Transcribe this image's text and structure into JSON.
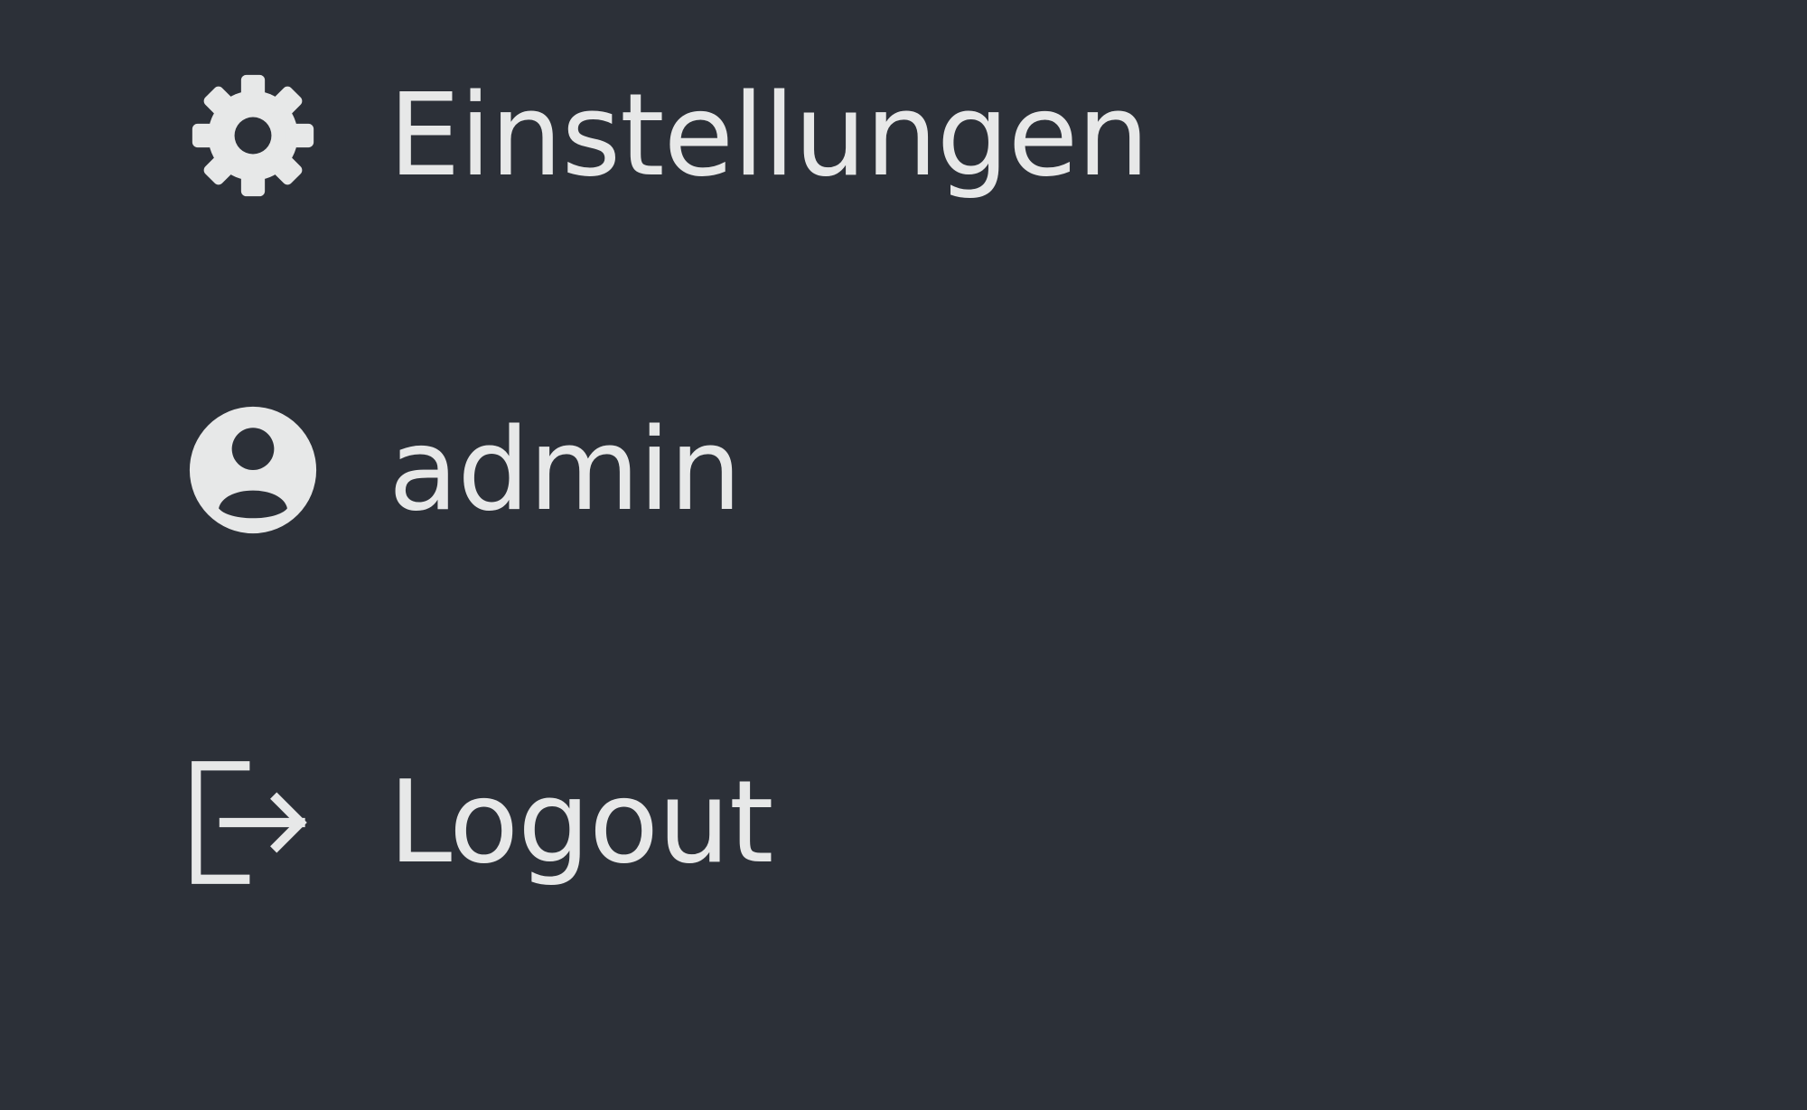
{
  "menu": {
    "items": [
      {
        "label": "Einstellungen",
        "icon": "gear-icon"
      },
      {
        "label": "admin",
        "icon": "user-circle-icon"
      },
      {
        "label": "Logout",
        "icon": "logout-icon"
      }
    ]
  },
  "colors": {
    "background": "#2c3038",
    "foreground": "#e7e8e8"
  }
}
